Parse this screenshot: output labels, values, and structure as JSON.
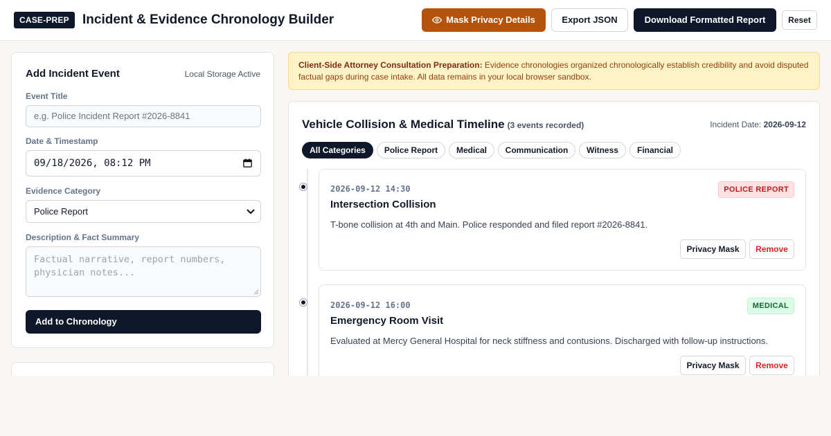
{
  "header": {
    "brand": "CASE-PREP",
    "title": "Incident & Evidence Chronology Builder",
    "mask_label": "Mask Privacy Details",
    "export_label": "Export JSON",
    "download_label": "Download Formatted Report",
    "reset_label": "Reset"
  },
  "form": {
    "title": "Add Incident Event",
    "storage_status": "Local Storage Active",
    "event_title_label": "Event Title",
    "event_title_placeholder": "e.g. Police Incident Report #2026-8841",
    "date_label": "Date & Timestamp",
    "date_value": "09/18/2026, 08:12 PM",
    "category_label": "Evidence Category",
    "category_value": "Police Report",
    "description_label": "Description & Fact Summary",
    "description_placeholder": "Factual narrative, report numbers,\nphysician notes...",
    "submit_label": "Add to Chronology"
  },
  "notice": {
    "heading": "Client-Side Attorney Consultation Preparation:",
    "body": " Evidence chronologies organized chronologically establish credibility and avoid disputed factual gaps during case intake. All data remains in your local browser sandbox."
  },
  "timeline": {
    "title": "Vehicle Collision & Medical Timeline",
    "count": "(3 events recorded)",
    "incident_date_label": "Incident Date:",
    "incident_date": "2026-09-12",
    "filters": [
      "All Categories",
      "Police Report",
      "Medical",
      "Communication",
      "Witness",
      "Financial"
    ],
    "events": [
      {
        "timestamp": "2026-09-12 14:30",
        "title": "Intersection Collision",
        "description": "T-bone collision at 4th and Main. Police responded and filed report #2026-8841.",
        "badge": "POLICE REPORT",
        "privacy_label": "Privacy Mask",
        "remove_label": "Remove"
      },
      {
        "timestamp": "2026-09-12 16:00",
        "title": "Emergency Room Visit",
        "description": "Evaluated at Mercy General Hospital for neck stiffness and contusions. Discharged with follow-up instructions.",
        "badge": "MEDICAL",
        "privacy_label": "Privacy Mask",
        "remove_label": "Remove"
      }
    ]
  },
  "colors": {
    "primary": "#0f172a",
    "accent": "#b45309",
    "notice_bg": "#fef3c7",
    "police_badge": "#b91c1c",
    "medical_badge": "#166534",
    "danger": "#dc2626"
  }
}
